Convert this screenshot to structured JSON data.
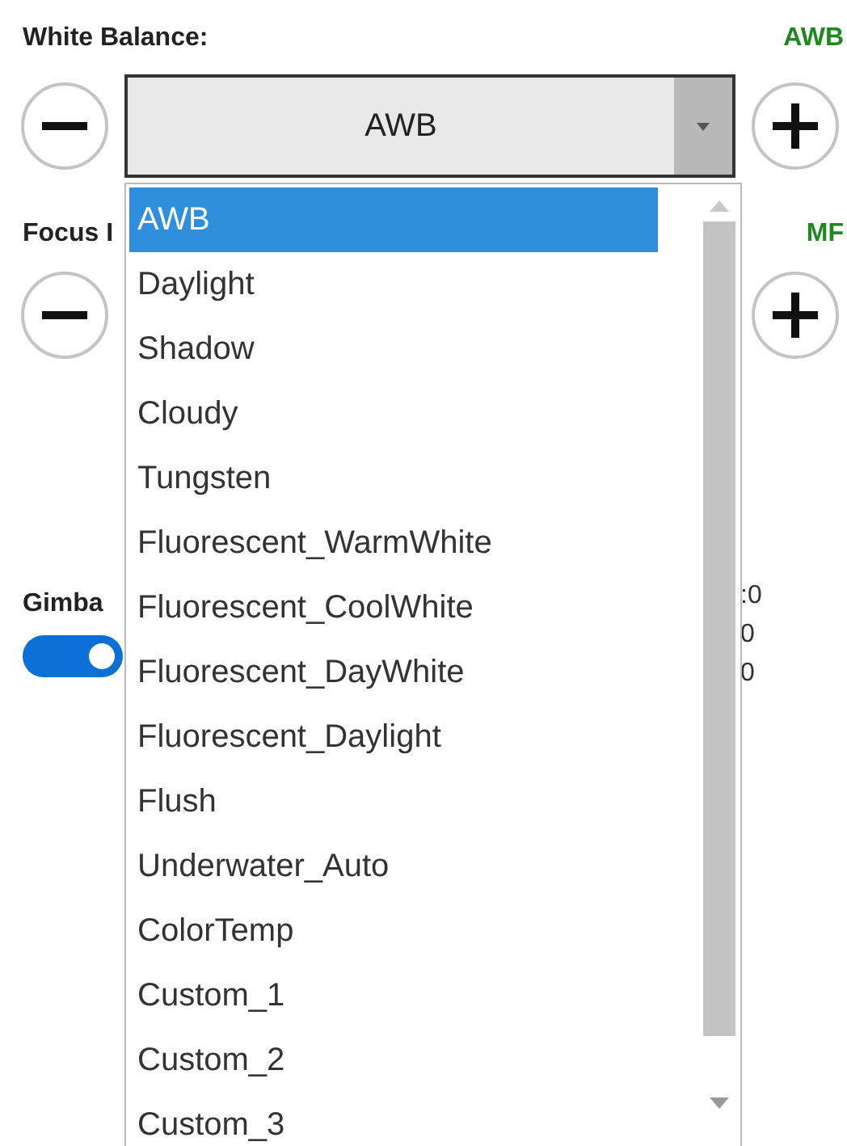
{
  "white_balance": {
    "label": "White Balance:",
    "value": "AWB",
    "combo_value": "AWB"
  },
  "focus": {
    "label": "Focus I",
    "value": "MF"
  },
  "gimbal": {
    "label": "Gimba",
    "on": true,
    "readings": [
      ":0",
      "0",
      "0"
    ]
  },
  "dropdown": {
    "items": [
      {
        "label": "AWB",
        "selected": true
      },
      {
        "label": "Daylight",
        "selected": false
      },
      {
        "label": "Shadow",
        "selected": false
      },
      {
        "label": "Cloudy",
        "selected": false
      },
      {
        "label": "Tungsten",
        "selected": false
      },
      {
        "label": "Fluorescent_WarmWhite",
        "selected": false
      },
      {
        "label": "Fluorescent_CoolWhite",
        "selected": false
      },
      {
        "label": "Fluorescent_DayWhite",
        "selected": false
      },
      {
        "label": "Fluorescent_Daylight",
        "selected": false
      },
      {
        "label": "Flush",
        "selected": false
      },
      {
        "label": "Underwater_Auto",
        "selected": false
      },
      {
        "label": "ColorTemp",
        "selected": false
      },
      {
        "label": "Custom_1",
        "selected": false
      },
      {
        "label": "Custom_2",
        "selected": false
      },
      {
        "label": "Custom_3",
        "selected": false
      }
    ]
  }
}
